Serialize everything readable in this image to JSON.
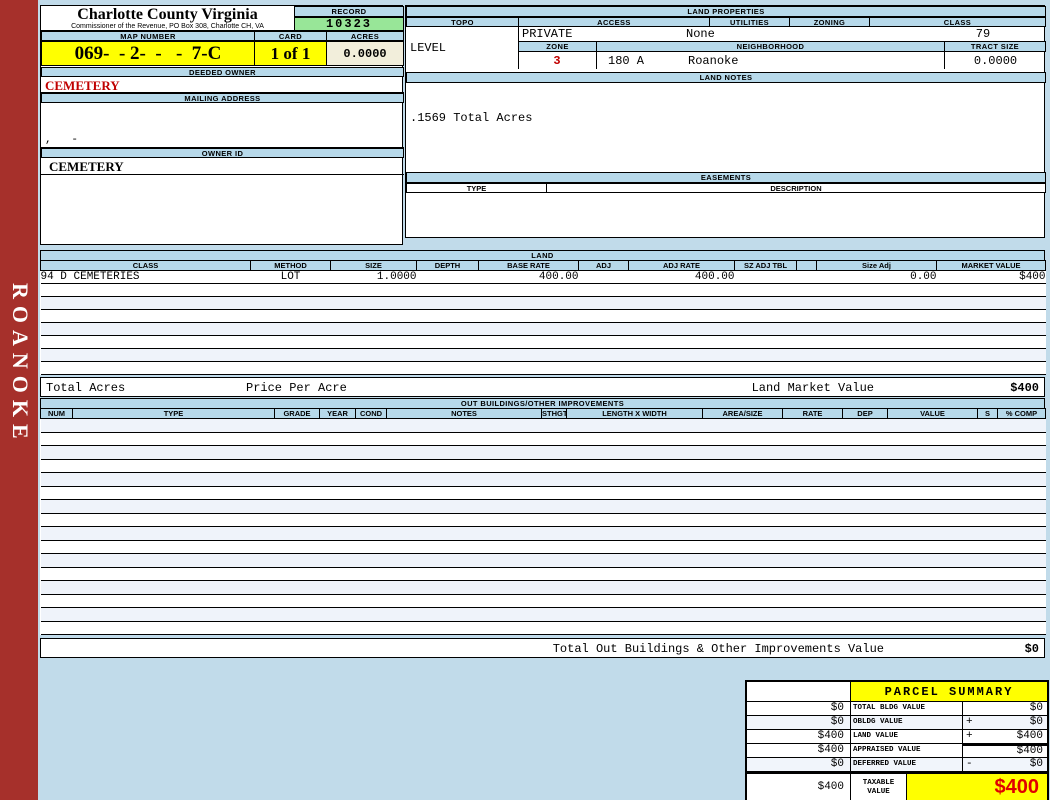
{
  "sidebar": {
    "district_label": "ROANOKE"
  },
  "header": {
    "county_title": "Charlotte County Virginia",
    "county_subtitle": "Commissioner of the Revenue, PO Box 308, Charlotte CH, VA",
    "record_label": "RECORD",
    "record_value": "10323",
    "map_number_label": "MAP NUMBER",
    "map_number_value": "069-  - 2-  -   -  7-C",
    "card_label": "CARD",
    "card_value": "1 of 1",
    "acres_label": "ACRES",
    "acres_value": "0.0000"
  },
  "owner": {
    "deeded_owner_label": "DEEDED OWNER",
    "deeded_owner_value": "CEMETERY",
    "mailing_address_label": "MAILING ADDRESS",
    "mailing_address_value": ",   -",
    "owner_id_label": "OWNER ID",
    "owner_id_value": "CEMETERY"
  },
  "land_properties": {
    "title": "LAND PROPERTIES",
    "topo_label": "TOPO",
    "topo_value": "LEVEL",
    "access_label": "ACCESS",
    "access_value": "PRIVATE",
    "utilities_label": "UTILITIES",
    "utilities_value": "None",
    "zoning_label": "ZONING",
    "zoning_value": "",
    "class_label": "CLASS",
    "class_value": "79",
    "zone_label": "ZONE",
    "zone_value": "3",
    "neighborhood_label": "NEIGHBORHOOD",
    "neighborhood_code": "180 A",
    "neighborhood_name": "Roanoke",
    "tract_size_label": "TRACT SIZE",
    "tract_size_value": "0.0000"
  },
  "land_notes": {
    "title": "LAND NOTES",
    "note": ".1569 Total Acres"
  },
  "easements": {
    "title": "EASEMENTS",
    "type_label": "TYPE",
    "description_label": "DESCRIPTION"
  },
  "land": {
    "title": "LAND",
    "headers": [
      "CLASS",
      "METHOD",
      "SIZE",
      "DEPTH",
      "BASE RATE",
      "ADJ",
      "ADJ RATE",
      "SZ ADJ TBL",
      "",
      "Size Adj",
      "MARKET VALUE"
    ],
    "rows": [
      [
        "94 D CEMETERIES",
        "LOT",
        "1.0000",
        "",
        "400.00",
        "",
        "400.00",
        "",
        "",
        "0.00",
        "$400"
      ]
    ],
    "empty_row_count": 7,
    "total_acres_label": "Total Acres",
    "price_per_acre_label": "Price Per Acre",
    "market_value_label": "Land Market Value",
    "market_value_total": "$400"
  },
  "out_buildings": {
    "title": "OUT BUILDINGS/OTHER IMPROVEMENTS",
    "headers": [
      "NUM",
      "TYPE",
      "GRADE",
      "YEAR",
      "COND",
      "NOTES",
      "STHGT",
      "LENGTH X WIDTH",
      "AREA/SIZE",
      "RATE",
      "DEP",
      "VALUE",
      "S",
      "% COMP"
    ],
    "empty_row_count": 16,
    "total_label": "Total Out Buildings & Other Improvements Value",
    "total_value": "$0"
  },
  "parcel_summary": {
    "title": "PARCEL SUMMARY",
    "rows": [
      {
        "carry": "$0",
        "label": "TOTAL BLDG VALUE",
        "sign": "",
        "value": "$0"
      },
      {
        "carry": "$0",
        "label": "OBLDG VALUE",
        "sign": "+",
        "value": "$0"
      },
      {
        "carry": "$400",
        "label": "LAND VALUE",
        "sign": "+",
        "value": "$400"
      },
      {
        "carry": "$400",
        "label": "APPRAISED VALUE",
        "sign": "",
        "value": "$400"
      },
      {
        "carry": "$0",
        "label": "DEFERRED VALUE",
        "sign": "-",
        "value": "$0"
      }
    ],
    "taxable_row": {
      "carry": "$400",
      "label": "TAXABLE VALUE",
      "value": "$400"
    }
  },
  "colors": {
    "strip_blue": "#B7D9EA",
    "record_green": "#98E698",
    "highlight_yellow": "#FFFF00",
    "acres_cream": "#F2EEDB",
    "sidebar_red": "#A6302B",
    "alert_red": "#C00000",
    "big_total_red": "#E00000",
    "page_blue": "#C1DBEA"
  }
}
